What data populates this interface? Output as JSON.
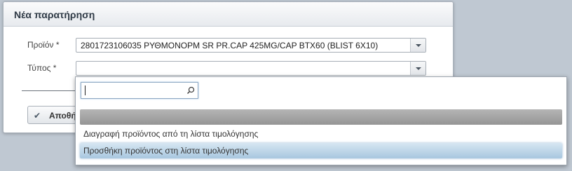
{
  "dialog": {
    "title": "Νέα παρατήρηση",
    "product_label": "Προϊόν *",
    "product_value": "2801723106035 ΡΥΘΜΟΝΟΡΜ SR PR.CAP 425MG/CAP BTX60 (BLIST 6X10)",
    "type_label": "Τύπος *",
    "type_value": "",
    "save_label": "Αποθήκευση"
  },
  "dropdown": {
    "search_value": "",
    "options": [
      {
        "label": ""
      },
      {
        "label": "Διαγραφή προϊόντος από τη λίστα τιμολόγησης"
      },
      {
        "label": "Προσθήκη προϊόντος στη λίστα τιμολόγησης"
      }
    ],
    "highlighted_index": 2
  },
  "icons": {
    "save": "check-icon",
    "search": "search-icon",
    "dropdown": "chevron-down-icon"
  },
  "colors": {
    "highlight": "#a8c7df",
    "empty_option": "#a5a5a5"
  }
}
